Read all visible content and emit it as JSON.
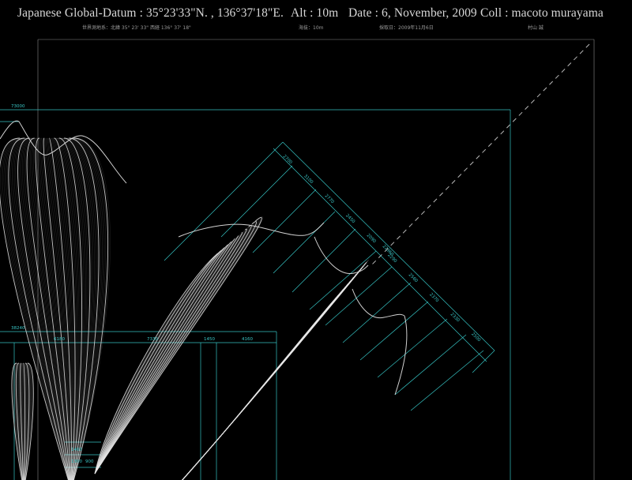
{
  "header": {
    "datum": "Japanese Global-Datum : 35°23'33\"N. , 136°37'18\"E.",
    "altitude": "Alt : 10m",
    "date": "Date : 6, November, 2009",
    "collector": "Coll : macoto murayama",
    "datum_jp": "世界測地系：北緯 35° 23' 33\"  西経 136° 37' 18\"",
    "altitude_jp": "海抜：10m",
    "date_jp": "採取日：2009年11月6日",
    "collector_jp": "村山 誠"
  },
  "dimensions": {
    "top_width": "73000",
    "left_width": "38240",
    "seg_a": "6180",
    "seg_b": "7330",
    "seg_c": "1450",
    "seg_d": "4160",
    "diag_total": "22960",
    "diag_labels": [
      "2700",
      "3100",
      "2770",
      "2450",
      "2090",
      "2290",
      "2560",
      "2370",
      "2330",
      "2500"
    ],
    "small_a": "1460",
    "small_b": "1300",
    "small_c": "900"
  },
  "colors": {
    "background": "#000000",
    "guide": "#35c2c2",
    "petal": "#e8e8e8",
    "text": "#d7d7d7"
  }
}
